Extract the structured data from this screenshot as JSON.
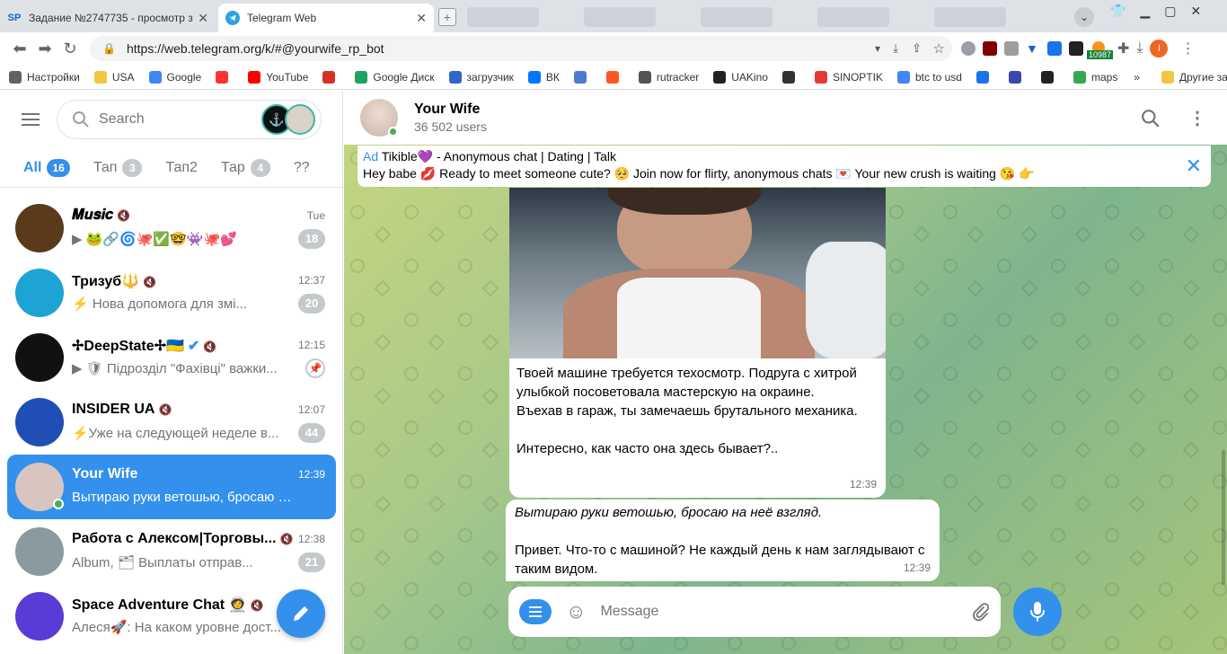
{
  "browser": {
    "tabs": [
      {
        "label": "Задание №2747735 - просмотр з",
        "favicon": "SP"
      },
      {
        "label": "Telegram Web",
        "favicon": "telegram-icon"
      }
    ],
    "url": "https://web.telegram.org/k/#@yourwife_rp_bot",
    "ext_badge": "10987",
    "profile_letter": "I"
  },
  "bookmarks": [
    {
      "label": "Настройки",
      "color": "#5f6368"
    },
    {
      "label": "USA",
      "color": "#f4c542"
    },
    {
      "label": "Google",
      "color": "#4285f4"
    },
    {
      "label": "",
      "color": "#ff3333"
    },
    {
      "label": "YouTube",
      "color": "#ff0000"
    },
    {
      "label": "",
      "color": "#d93025"
    },
    {
      "label": "Google Диск",
      "color": "#1ea362"
    },
    {
      "label": "загрузчик",
      "color": "#3366cc"
    },
    {
      "label": "ВК",
      "color": "#0077ff"
    },
    {
      "label": "",
      "color": "#4a7bd0"
    },
    {
      "label": "",
      "color": "#ff5722"
    },
    {
      "label": "rutracker",
      "color": "#555555"
    },
    {
      "label": "UAKino",
      "color": "#222222"
    },
    {
      "label": "",
      "color": "#333333"
    },
    {
      "label": "SINOPTIK",
      "color": "#e53935"
    },
    {
      "label": "btc to usd",
      "color": "#4285f4"
    },
    {
      "label": "",
      "color": "#1a73e8"
    },
    {
      "label": "",
      "color": "#3949ab"
    },
    {
      "label": "",
      "color": "#222222"
    },
    {
      "label": "maps",
      "color": "#34a853"
    }
  ],
  "bookmarks_more": "»",
  "bookmarks_other": "Другие закладки",
  "sidebar": {
    "search_placeholder": "Search",
    "folders": [
      {
        "label": "All",
        "badge": "16",
        "active": true
      },
      {
        "label": "Тап",
        "badge": "3",
        "active": false
      },
      {
        "label": "Тап2",
        "badge": "",
        "active": false
      },
      {
        "label": "Тар",
        "badge": "4",
        "active": false
      },
      {
        "label": "??",
        "badge": "",
        "active": false
      }
    ],
    "chats": [
      {
        "title": "𝑴𝒖𝒔𝒊𝒄",
        "time": "Tue",
        "preview": "▶ 🐸🔗🌀🐙✅🤓👾🐙💕",
        "unread": "18",
        "avatar_color": "#5a3a1a",
        "muted": true
      },
      {
        "title": "Тризуб🔱",
        "time": "12:37",
        "preview": "⚡ Нова допомога для змі...",
        "unread": "20",
        "avatar_color": "#1ea4d4",
        "muted": true
      },
      {
        "title": "✢DeepState✢🇺🇦",
        "time": "12:15",
        "preview": "▶ 🛡 Підрозділ \"Фахівці\" важки...",
        "unread": "",
        "avatar_color": "#111111",
        "muted": true,
        "verified": true
      },
      {
        "title": "INSIDER UA",
        "time": "12:07",
        "preview": "⚡Уже на следующей неделе в...",
        "unread": "44",
        "avatar_color": "#1f4fb5",
        "muted": true
      },
      {
        "title": "Your Wife",
        "time": "12:39",
        "preview": "Вытираю руки ветошью, бросаю на ...",
        "unread": "",
        "avatar_color": "#d9c5c0",
        "selected": true,
        "online": true
      },
      {
        "title": "Работа с Алексом|Торговы...",
        "time": "12:38",
        "preview": "Album, 🗂 Выплаты отправ...",
        "unread": "21",
        "avatar_color": "#8a9a9e",
        "muted": true
      },
      {
        "title": "Space Adventure Chat 🧑‍🚀",
        "time": "",
        "preview": "Алеся🚀: На каком уровне дост...",
        "unread": "",
        "avatar_color": "#5a3bd6",
        "muted": true
      }
    ]
  },
  "header": {
    "name": "Your Wife",
    "status": "36 502 users"
  },
  "ad": {
    "tag": "Ad",
    "title": "Tikible💜 - Anonymous chat | Dating | Talk",
    "text": "Hey babe 💋 Ready to meet someone cute? 🥺 Join now for flirty, anonymous chats 💌 Your new crush is waiting 😘 👉"
  },
  "messages": [
    {
      "text": "Твоей машине требуется техосмотр. Подруга с хитрой улыбкой посоветовала мастерскую на окраине.\nВъехав в гараж, ты замечаешь брутального механика.\n\nИнтересно, как часто она здесь бывает?..",
      "time": "12:39"
    },
    {
      "text_italic": "Вытираю руки ветошью, бросаю на неё взгляд.",
      "text": "Привет. Что-то с машиной? Не каждый день к нам заглядывают с таким видом.",
      "time": "12:39"
    }
  ],
  "composer": {
    "placeholder": "Message"
  },
  "colors": {
    "accent": "#3390ec",
    "muted_badge": "#c4c9cc"
  }
}
